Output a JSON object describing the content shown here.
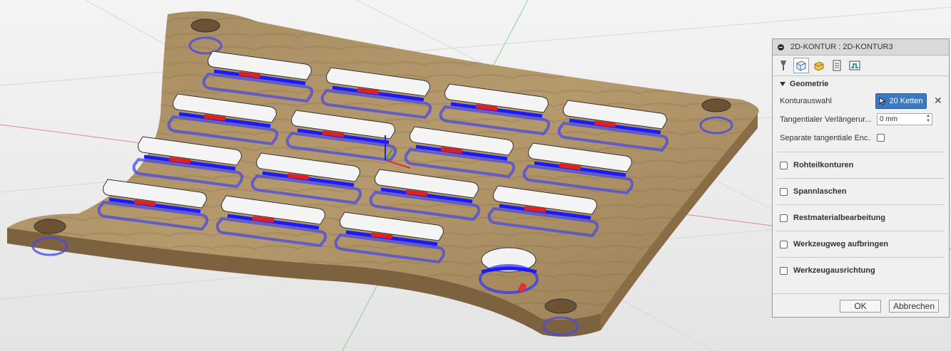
{
  "panel": {
    "title": "2D-KONTUR : 2D-KONTUR3",
    "tabs": [
      {
        "name": "tool-icon"
      },
      {
        "name": "geometry-icon"
      },
      {
        "name": "heights-icon"
      },
      {
        "name": "passes-icon"
      },
      {
        "name": "linking-icon"
      }
    ],
    "geometry_header": "Geometrie",
    "contour_selection_label": "Konturauswahl",
    "contour_selection_button": "20 Ketten",
    "tangent_extension_label": "Tangentialer Verlängerur...",
    "tangent_extension_value": "0 mm",
    "separate_tangent_label": "Separate tangentiale Enc...",
    "groups": [
      "Rohteilkonturen",
      "Spannlaschen",
      "Restmaterialbearbeitung",
      "Werkzeugweg aufbringen",
      "Werkzeugausrichtung"
    ],
    "ok_label": "OK",
    "cancel_label": "Abbrechen"
  },
  "colors": {
    "accent": "#3a78c0",
    "toolpath": "#1a1aff",
    "wood": "#a88a5e"
  }
}
